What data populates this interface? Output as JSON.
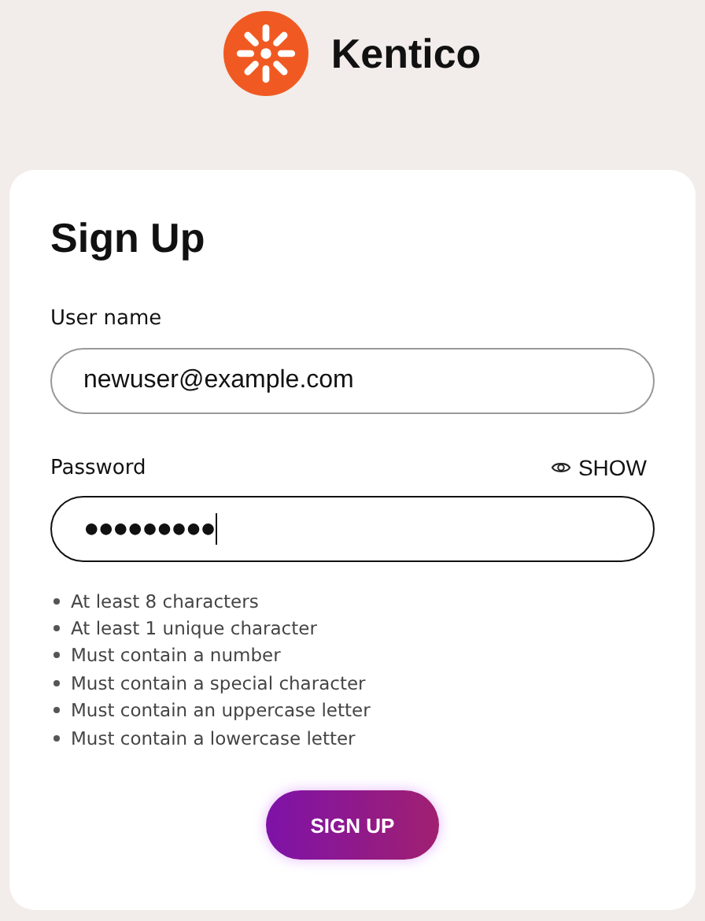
{
  "brand": {
    "name": "Kentico"
  },
  "form": {
    "title": "Sign Up",
    "username": {
      "label": "User name",
      "value": "newuser@example.com"
    },
    "password": {
      "label": "Password",
      "toggle": "SHOW",
      "value": "●●●●●●●●●",
      "focused": true
    },
    "rules": [
      "At least 8 characters",
      "At least 1 unique character",
      "Must contain a number",
      "Must contain a special character",
      "Must contain an uppercase letter",
      "Must contain a lowercase letter"
    ],
    "submit": "SIGN UP"
  }
}
